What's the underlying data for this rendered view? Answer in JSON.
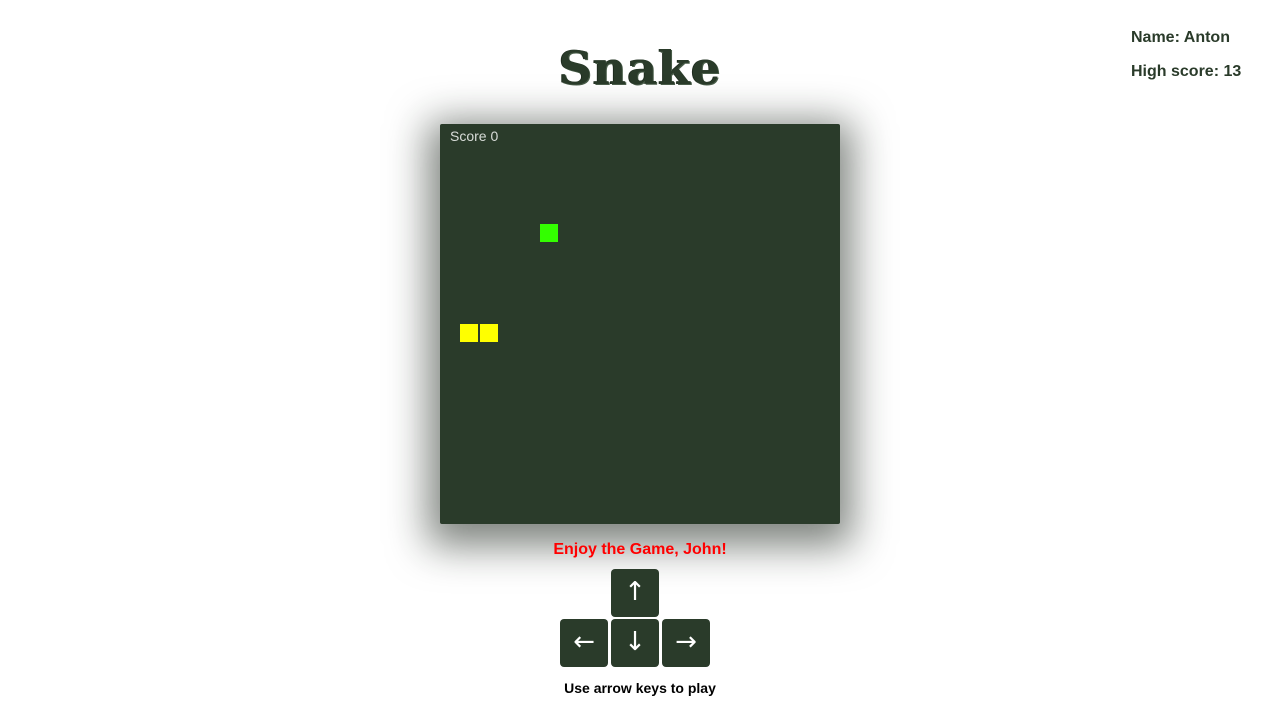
{
  "player": {
    "name_text": "Name: Anton",
    "high_score_text": "High score: 13"
  },
  "title": "Snake",
  "board": {
    "score_text": "Score 0",
    "background_color": "#2a3b2a",
    "food_color": "#33ff00",
    "snake_color": "#ffff00"
  },
  "message": "Enjoy the Game, John!",
  "controls": {
    "up": "↑",
    "left": "←",
    "down": "↓",
    "right": "→"
  },
  "hint": "Use arrow keys to play"
}
